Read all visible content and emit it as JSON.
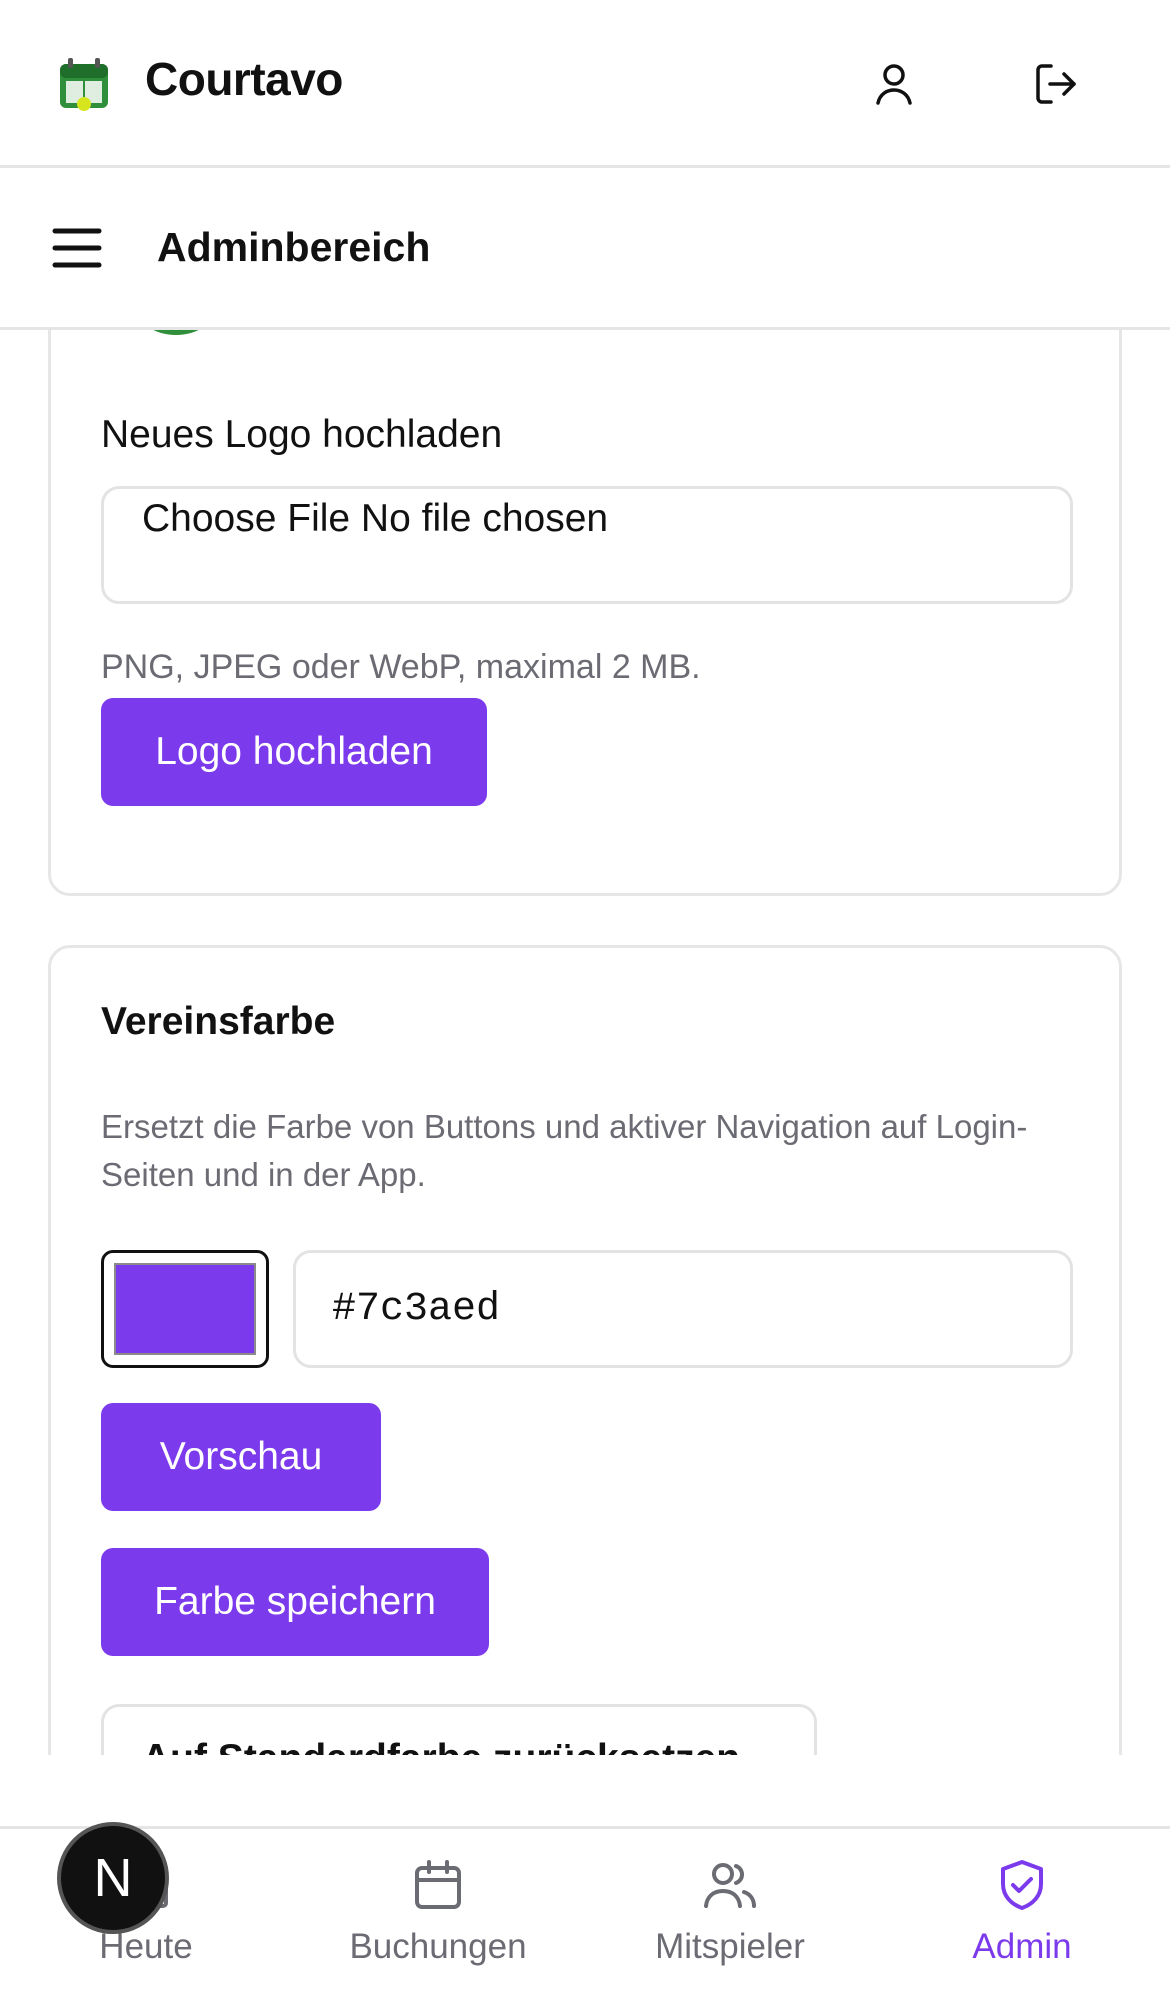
{
  "header": {
    "app_name": "Courtavo",
    "logo": "courtavo-logo",
    "icons": [
      "user-icon",
      "logout-icon"
    ]
  },
  "subheader": {
    "menu_icon": "hamburger-menu-icon",
    "title": "Adminbereich"
  },
  "logo_card": {
    "upload_label": "Neues Logo hochladen",
    "file_input_text": "Choose File No file chosen",
    "hint": "PNG, JPEG oder WebP, maximal 2 MB.",
    "upload_button": "Logo hochladen"
  },
  "color_card": {
    "title": "Vereinsfarbe",
    "description": "Ersetzt die Farbe von Buttons und aktiver Navigation auf Login-Seiten und in der App.",
    "color_value": "#7c3aed",
    "preview_button": "Vorschau",
    "save_button": "Farbe speichern",
    "reset_button": "Auf Standardfarbe zurücksetzen"
  },
  "bottom_nav": {
    "items": [
      {
        "label": "Heute",
        "icon": "home-icon",
        "active": false
      },
      {
        "label": "Buchungen",
        "icon": "calendar-icon",
        "active": false
      },
      {
        "label": "Mitspieler",
        "icon": "users-icon",
        "active": false
      },
      {
        "label": "Admin",
        "icon": "shield-check-icon",
        "active": true
      }
    ]
  },
  "dev_badge": {
    "letter": "N"
  },
  "colors": {
    "accent": "#7c3aed",
    "muted_text": "#6b6b73",
    "border": "#e5e5e5"
  }
}
